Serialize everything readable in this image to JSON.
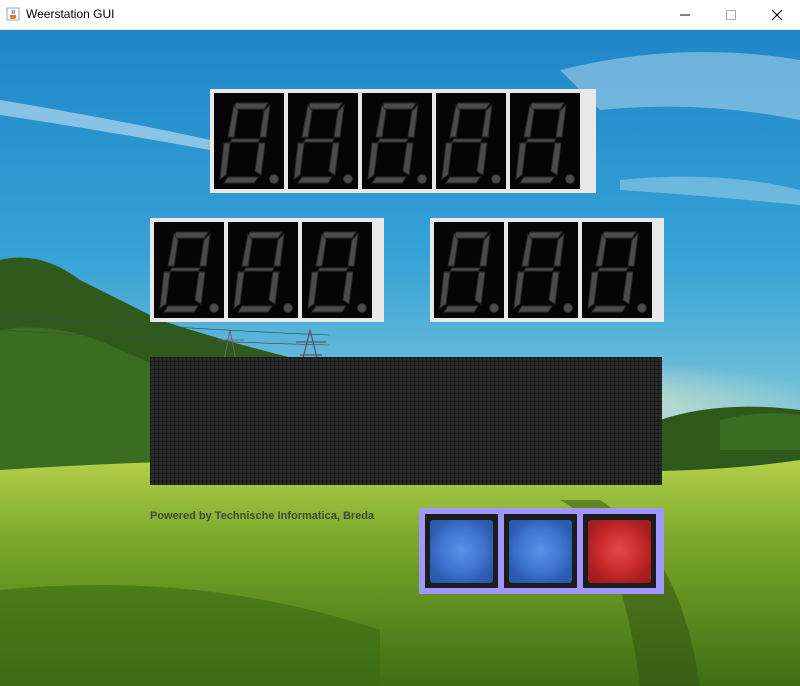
{
  "window": {
    "title": "Weerstation GUI",
    "icons": {
      "app": "java-cup-icon",
      "minimize": "minimize-icon",
      "maximize": "maximize-icon",
      "close": "close-icon"
    }
  },
  "displays": {
    "top": {
      "digit_count": 5
    },
    "left": {
      "digit_count": 3
    },
    "right": {
      "digit_count": 3
    }
  },
  "footer": {
    "credit": "Powered by Technische Informatica, Breda"
  },
  "buttons": [
    {
      "name": "blue-button-1",
      "color": "#3f74cf"
    },
    {
      "name": "blue-button-2",
      "color": "#3f74cf"
    },
    {
      "name": "red-button",
      "color": "#c82a2a"
    }
  ],
  "colors": {
    "segment_off": "#4b4b4b",
    "digit_bg": "#050505",
    "panel_bg": "#e8e8e8",
    "button_panel": "#9f96ff"
  }
}
